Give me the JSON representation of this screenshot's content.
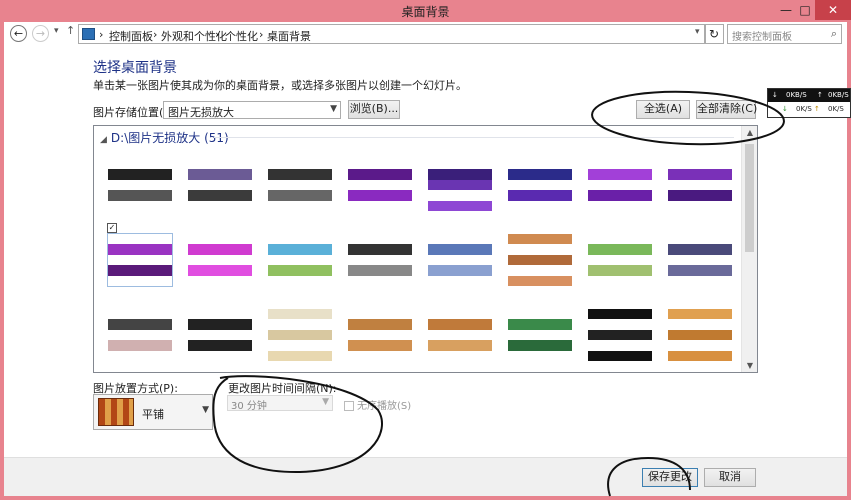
{
  "window": {
    "title": "桌面背景",
    "minimize_glyph": "—",
    "maximize_glyph": "□",
    "close_glyph": "✕"
  },
  "address_bar": {
    "back_glyph": "←",
    "forward_glyph": "→",
    "recent_glyph": "▾",
    "up_glyph": "↑",
    "crumbs": [
      "控制面板",
      "外观和个性化",
      "个性化",
      "桌面背景"
    ],
    "separator": "›",
    "search_placeholder": "搜索控制面板",
    "refresh_glyph": "↻",
    "search_glyph": "⌕"
  },
  "page": {
    "heading": "选择桌面背景",
    "subtitle": "单击某一张图片使其成为你的桌面背景，或选择多张图片以创建一个幻灯片。"
  },
  "picture_location": {
    "label": "图片存储位置(L):",
    "value": "图片无损放大",
    "browse_label": "浏览(B)..."
  },
  "actions": {
    "select_all_label": "全选(A)",
    "clear_all_label": "全部清除(C)"
  },
  "network_widget": {
    "upload": "0KB/S",
    "download": "0K/S",
    "upload2": "0K/S",
    "arrow_up": "↑",
    "arrow_down": "↓"
  },
  "gallery": {
    "group_title": "D:\\图片无损放大 (51)",
    "collapse_glyph": "◢",
    "selected_index": 8,
    "rows": [
      [
        {
          "colors": [
            "#ffffff",
            "#222222",
            "#ffffff",
            "#555555",
            "#ffffff"
          ]
        },
        {
          "colors": [
            "#ffffff",
            "#6b5b95",
            "#ffffff",
            "#3b3b3b",
            "#ffffff"
          ]
        },
        {
          "colors": [
            "#ffffff",
            "#333333",
            "#ffffff",
            "#666666",
            "#ffffff"
          ]
        },
        {
          "colors": [
            "#ffffff",
            "#5b1a8a",
            "#ffffff",
            "#8a2ac0",
            "#ffffff"
          ]
        },
        {
          "colors": [
            "#ffffff",
            "#3a1f7a",
            "#6a35b2",
            "#ffffff",
            "#8e47d4"
          ]
        },
        {
          "colors": [
            "#ffffff",
            "#2b2b8a",
            "#ffffff",
            "#5a2ab0",
            "#ffffff"
          ]
        },
        {
          "colors": [
            "#ffffff",
            "#a240d8",
            "#ffffff",
            "#6a20a8",
            "#ffffff"
          ]
        },
        {
          "colors": [
            "#ffffff",
            "#7a30b8",
            "#ffffff",
            "#4a1a80",
            "#ffffff"
          ]
        }
      ],
      [
        {
          "colors": [
            "#ffffff",
            "#9a33c2",
            "#ffffff",
            "#5a1a7a",
            "#ffffff"
          ]
        },
        {
          "colors": [
            "#ffffff",
            "#d03bd0",
            "#ffffff",
            "#e04ee0",
            "#ffffff"
          ]
        },
        {
          "colors": [
            "#ffffff",
            "#5ab0d8",
            "#ffffff",
            "#90c060",
            "#ffffff"
          ]
        },
        {
          "colors": [
            "#ffffff",
            "#333333",
            "#ffffff",
            "#888888",
            "#ffffff"
          ]
        },
        {
          "colors": [
            "#ffffff",
            "#5a78b8",
            "#ffffff",
            "#8aa0d0",
            "#ffffff"
          ]
        },
        {
          "colors": [
            "#d08a50",
            "#ffffff",
            "#b06a3a",
            "#ffffff",
            "#d89060"
          ]
        },
        {
          "colors": [
            "#ffffff",
            "#7ab85a",
            "#ffffff",
            "#a0c070",
            "#ffffff"
          ]
        },
        {
          "colors": [
            "#ffffff",
            "#4a4a7a",
            "#ffffff",
            "#6a6a9a",
            "#ffffff"
          ]
        }
      ],
      [
        {
          "colors": [
            "#ffffff",
            "#444444",
            "#ffffff",
            "#d0b0b0",
            "#ffffff"
          ]
        },
        {
          "colors": [
            "#ffffff",
            "#222222",
            "#ffffff",
            "#222222",
            "#ffffff"
          ]
        },
        {
          "colors": [
            "#e8e0c8",
            "#ffffff",
            "#d8c8a0",
            "#ffffff",
            "#e8d8b0"
          ]
        },
        {
          "colors": [
            "#ffffff",
            "#c08040",
            "#ffffff",
            "#d09050",
            "#ffffff"
          ]
        },
        {
          "colors": [
            "#ffffff",
            "#c07a3a",
            "#ffffff",
            "#d8a060",
            "#ffffff"
          ]
        },
        {
          "colors": [
            "#ffffff",
            "#3a8a4a",
            "#ffffff",
            "#2a6a3a",
            "#ffffff"
          ]
        },
        {
          "colors": [
            "#111111",
            "#ffffff",
            "#222222",
            "#ffffff",
            "#111111"
          ]
        },
        {
          "colors": [
            "#e0a050",
            "#ffffff",
            "#c07a30",
            "#ffffff",
            "#d89040"
          ]
        }
      ]
    ]
  },
  "picture_position": {
    "label": "图片放置方式(P):",
    "value": "平铺"
  },
  "interval": {
    "label": "更改图片时间间隔(N):",
    "value": "30 分钟",
    "shuffle_label": "无序播放(S)"
  },
  "footer": {
    "save_label": "保存更改",
    "cancel_label": "取消"
  }
}
